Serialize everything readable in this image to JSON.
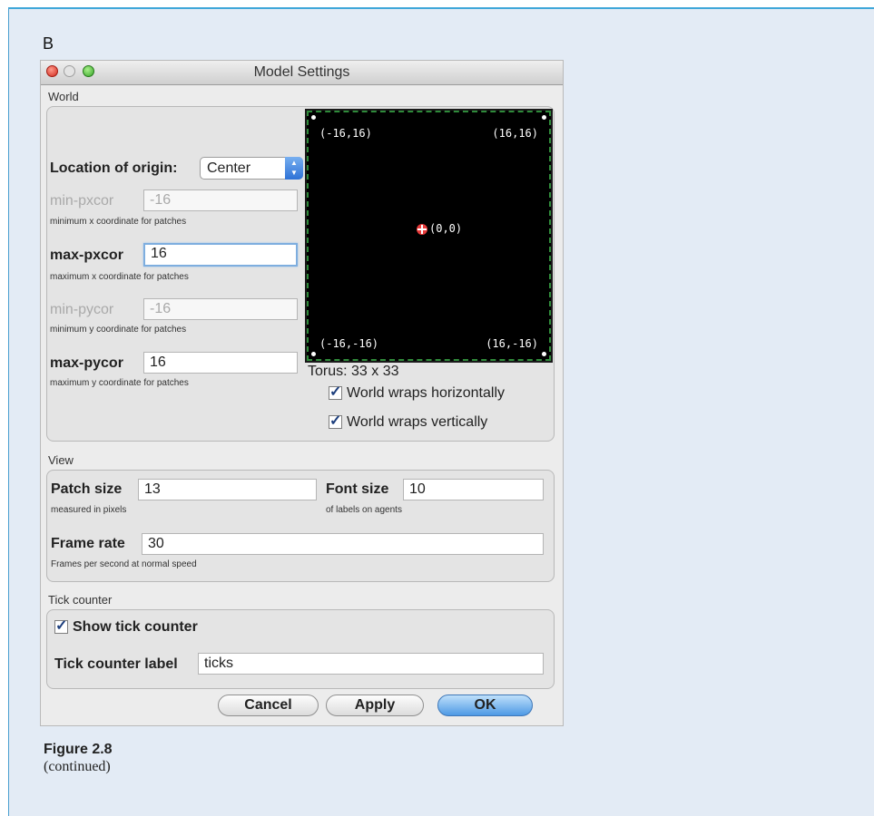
{
  "panel_letter": "B",
  "window": {
    "title": "Model Settings"
  },
  "world": {
    "section_label": "World",
    "origin_label": "Location of origin:",
    "origin_value": "Center",
    "fields": {
      "min_pxcor": {
        "label": "min-pxcor",
        "value": "-16",
        "hint": "minimum x coordinate for patches"
      },
      "max_pxcor": {
        "label": "max-pxcor",
        "value": "16",
        "hint": "maximum x coordinate for patches"
      },
      "min_pycor": {
        "label": "min-pycor",
        "value": "-16",
        "hint": "minimum y coordinate for patches"
      },
      "max_pycor": {
        "label": "max-pycor",
        "value": "16",
        "hint": "maximum y coordinate for patches"
      }
    },
    "preview": {
      "top_left": "(-16,16)",
      "top_right": "(16,16)",
      "center": "(0,0)",
      "bottom_left": "(-16,-16)",
      "bottom_right": "(16,-16)"
    },
    "torus_label": "Torus: 33 x 33",
    "wrap_horizontal": "World wraps horizontally",
    "wrap_vertical": "World wraps vertically"
  },
  "view": {
    "section_label": "View",
    "patch_size": {
      "label": "Patch size",
      "value": "13",
      "hint": "measured in pixels"
    },
    "font_size": {
      "label": "Font size",
      "value": "10",
      "hint": "of labels on agents"
    },
    "frame_rate": {
      "label": "Frame rate",
      "value": "30",
      "hint": "Frames per second at normal speed"
    }
  },
  "tick_counter": {
    "section_label": "Tick counter",
    "show_label": "Show tick counter",
    "label_label": "Tick counter label",
    "label_value": "ticks"
  },
  "buttons": {
    "cancel": "Cancel",
    "apply": "Apply",
    "ok": "OK"
  },
  "figure": {
    "title": "Figure 2.8",
    "subtitle": "(continued)"
  },
  "colors": {
    "panel_bg": "#e3ebf5",
    "panel_border": "#3fa7d9",
    "world_bg": "#000000",
    "world_border": "#2f8a3a",
    "ok_button": "#4d99e5"
  }
}
